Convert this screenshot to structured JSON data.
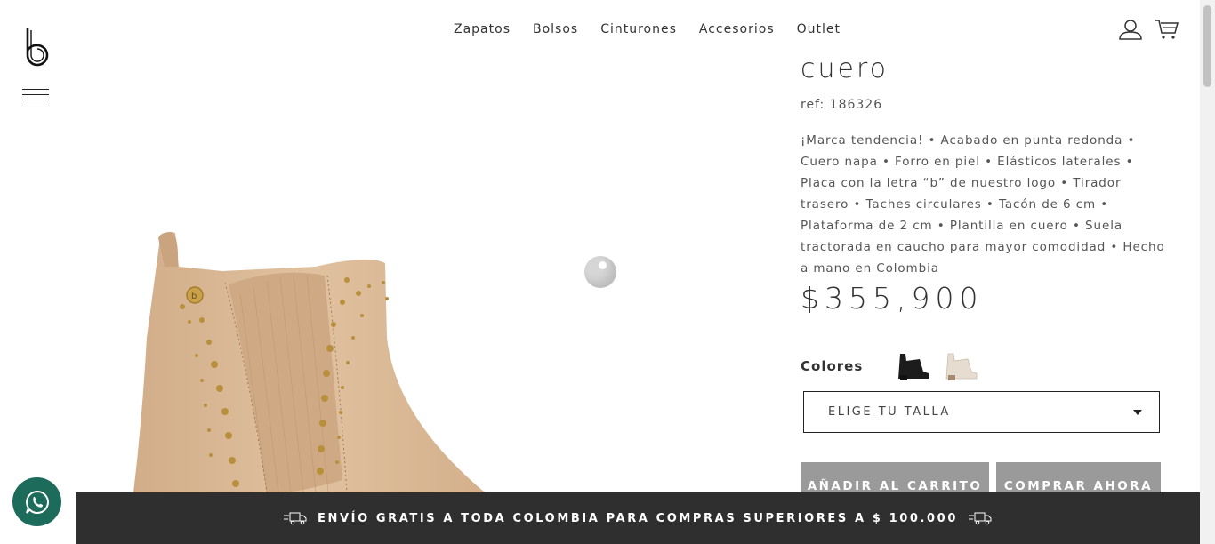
{
  "header": {
    "nav": [
      {
        "label": "Zapatos"
      },
      {
        "label": "Bolsos"
      },
      {
        "label": "Cinturones"
      },
      {
        "label": "Accesorios"
      },
      {
        "label": "Outlet"
      }
    ],
    "icons": [
      "logo-b-icon",
      "menu-icon",
      "user-icon",
      "cart-icon"
    ]
  },
  "product": {
    "title": "cuero",
    "ref": "ref: 186326",
    "description": "¡Marca tendencia! • Acabado en punta redonda • Cuero napa • Forro en piel • Elásticos laterales • Placa con la letra “b” de nuestro logo • Tirador trasero • Taches circulares • Tacón de 6 cm • Plataforma de 2 cm • Plantilla en cuero • Suela tractorada en caucho para mayor comodidad • Hecho a mano en Colombia",
    "price": "$355,900",
    "colors_label": "Colores",
    "colors": [
      {
        "name": "black-boot-swatch",
        "hex": "#1c1c1c"
      },
      {
        "name": "cream-boot-swatch",
        "hex": "#e6ddd0"
      }
    ],
    "size_placeholder": "ELIGE TU TALLA",
    "add_to_cart": "AÑADIR AL CARRITO",
    "buy_now": "COMPRAR AHORA",
    "image_color": "#dcb794"
  },
  "banner": {
    "text": "ENVÍO GRATIS A TODA COLOMBIA PARA COMPRAS SUPERIORES A $ 100.000"
  },
  "colors": {
    "banner_bg": "#2f2f2f",
    "button_bg": "#9a9a9a",
    "whatsapp": "#1d6b5b"
  }
}
